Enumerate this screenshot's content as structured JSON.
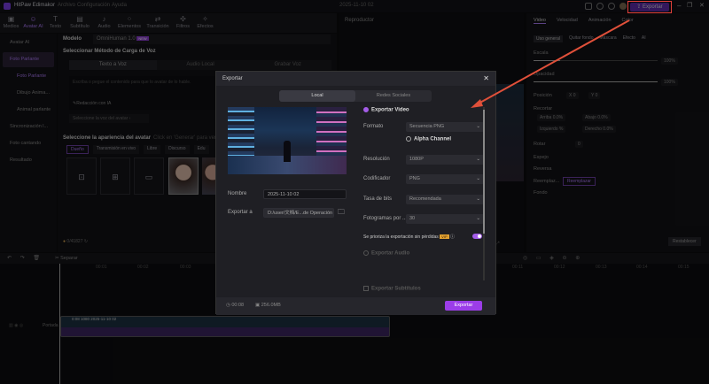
{
  "app": {
    "title": "HitPaw Edimakor",
    "menus": [
      "Archivo",
      "Configuración",
      "Ayuda"
    ],
    "project": "2025-11-10 02",
    "export_label": "Exportar"
  },
  "toolbar": [
    "Medios",
    "Avatar AI",
    "Texto",
    "Subtítulo",
    "Audio",
    "Elementos",
    "Transición",
    "Filtros",
    "Efectos"
  ],
  "sidebar": [
    "Avatar AI",
    "Foto Parlante",
    "Foto Parlante",
    "Dibujo Anima...",
    "Animal parlante",
    "Sincronización l...",
    "Foto cantando",
    "Resultado"
  ],
  "middle": {
    "step1": "Modelo",
    "model": "OmniHuman 1.0",
    "model_badge": "NEW",
    "step2": "Seleccionar Método de Carga de Voz",
    "voice_tabs": [
      "Texto a Voz",
      "Audio Local",
      "Grabar Voz"
    ],
    "placeholder": "Escriba o pegue el contenido para que lo avatar de lo hable.",
    "ai_write": "Redacción con IA",
    "select_voice": "Seleccione la voz del avatar",
    "step3": "Seleccione la apariencia del avatar",
    "step3_hint": "Click en 'Generar' para ver",
    "appearance_tabs": [
      "Dueño",
      "Transmisión en vivo",
      "Libre",
      "Discurso",
      "Edu"
    ],
    "credits": "0/41827"
  },
  "player": {
    "title": "Reproductor"
  },
  "right": {
    "tabs": [
      "Video",
      "Velocidad",
      "Animación",
      "Color"
    ],
    "subtabs": [
      "Uso general",
      "Quitar fondo",
      "Máscara",
      "Efecto",
      "AI"
    ],
    "scale_label": "Escala",
    "scale": "100%",
    "opacity_label": "Opacidad",
    "opacity": "100%",
    "position_label": "Posición",
    "x": "0",
    "y": "0",
    "crop_label": "Recortar",
    "arriba": "Arriba",
    "arriba_v": "0.0%",
    "abajo": "Abajo",
    "abajo_v": "0.0%",
    "izq": "Izquierdo",
    "izq_v": "%",
    "der": "Derecho",
    "der_v": "0.0%",
    "rotate_label": "Rotar",
    "rotate": "0",
    "mirror_label": "Espejo",
    "reverse_label": "Reversa",
    "replace_label": "Reemplaz...",
    "replace_btn": "Reemplazar",
    "bg_label": "Fondo",
    "reset": "Restablecer"
  },
  "timeline": {
    "split": "Separar",
    "ticks": [
      "00:01",
      "00:02",
      "00:03",
      "00:11",
      "00:12",
      "00:13",
      "00:14",
      "00:15"
    ],
    "track_label": "Portada",
    "clip": "0:08  1080  2025-11-10 02"
  },
  "modal": {
    "title": "Exportar",
    "tabs": [
      "Local",
      "Redes Sociales"
    ],
    "name_label": "Nombre",
    "name": "2025-11-10 02",
    "path_label": "Exportar a",
    "path": "D:/user/文档/E...de Operación",
    "export_video": "Exportar Video",
    "format_label": "Formato",
    "format": "Secuencia PNG",
    "alpha": "Alpha Channel",
    "res_label": "Resolución",
    "res": "1080P",
    "codec_label": "Codificador",
    "codec": "PNG",
    "bitrate_label": "Tasa de bits",
    "bitrate": "Recomendada",
    "fps_label": "Fotogramas por ...",
    "fps": "30",
    "lossless": "Se prioriza la exportación sin pérdidas",
    "vip": "VIP",
    "export_audio": "Exportar Audio",
    "export_subs": "Exportar Subtítulos",
    "duration": "00:08",
    "size": "256.0MB",
    "export_btn": "Exportar"
  }
}
